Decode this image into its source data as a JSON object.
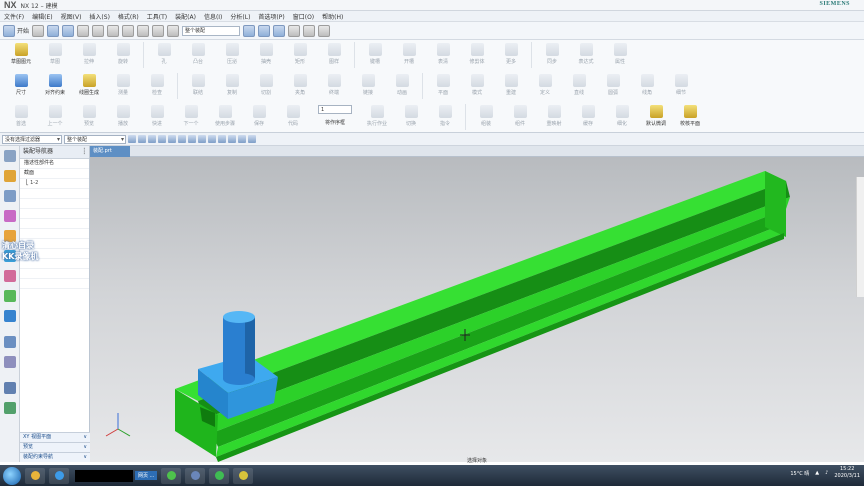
{
  "window": {
    "app_logo": "NX",
    "title": "NX 12 – 建模",
    "brand": "SIEMENS"
  },
  "menubar": {
    "items": [
      "文件(F)",
      "编辑(E)",
      "视图(V)",
      "插入(S)",
      "格式(R)",
      "工具(T)",
      "装配(A)",
      "信息(I)",
      "分析(L)",
      "首选项(P)",
      "窗口(O)",
      "帮助(H)"
    ]
  },
  "qat": {
    "start_label": "开始",
    "filter_placeholder": "整个装配"
  },
  "ribbon": {
    "row1": [
      "草图图元",
      "草图",
      "拉伸",
      "旋转",
      "孔",
      "凸台",
      "压泌",
      "抽壳",
      "矩形",
      "图样",
      "键槽",
      "开槽",
      "表清",
      "修剪体",
      "更多",
      "同步",
      "表达式",
      "属性"
    ],
    "row2": [
      "尺寸",
      "对齐约束",
      "线圈生成",
      "测量",
      "检查",
      "联结",
      "复制",
      "切割",
      "夹角",
      "终端",
      "链接",
      "动画",
      "平面",
      "模式",
      "重建",
      "定义",
      "直线",
      "圆弧",
      "线角",
      "细节"
    ],
    "row3": [
      "首选",
      "上一个",
      "预览",
      "播放",
      "快进",
      "下一个",
      "使用步骤",
      "保存",
      "代码",
      "执行作业",
      "切换",
      "指令",
      "组装",
      "组件",
      "重映射",
      "缓存",
      "细化",
      "默认微调",
      "校核平面"
    ],
    "step_value": "1",
    "row3_select_label": "将作序框"
  },
  "selection_bar": {
    "filter": "没有选择过滤器",
    "scope": "整个装配"
  },
  "navigator": {
    "title": "装配导航器",
    "header_col": "描述性部件名",
    "rows": [
      "截面",
      "⎣ 1-2"
    ],
    "bottom_panes": [
      "XY 视图平面",
      "预览",
      "装配约束导航"
    ]
  },
  "overlay": {
    "watermark_line1": "清心自录",
    "watermark_line2": "KK录像机"
  },
  "graphics": {
    "tab_label": "装配.prt",
    "status": "选择对象",
    "colors": {
      "rail": "#2fd62c",
      "rail_dark": "#1aa318",
      "block": "#2f9de8",
      "pin": "#2a7fd0"
    }
  },
  "taskbar": {
    "weather": "15°C 晴",
    "time": "15:22",
    "date": "2020/3/11",
    "label": "网页 ..."
  }
}
